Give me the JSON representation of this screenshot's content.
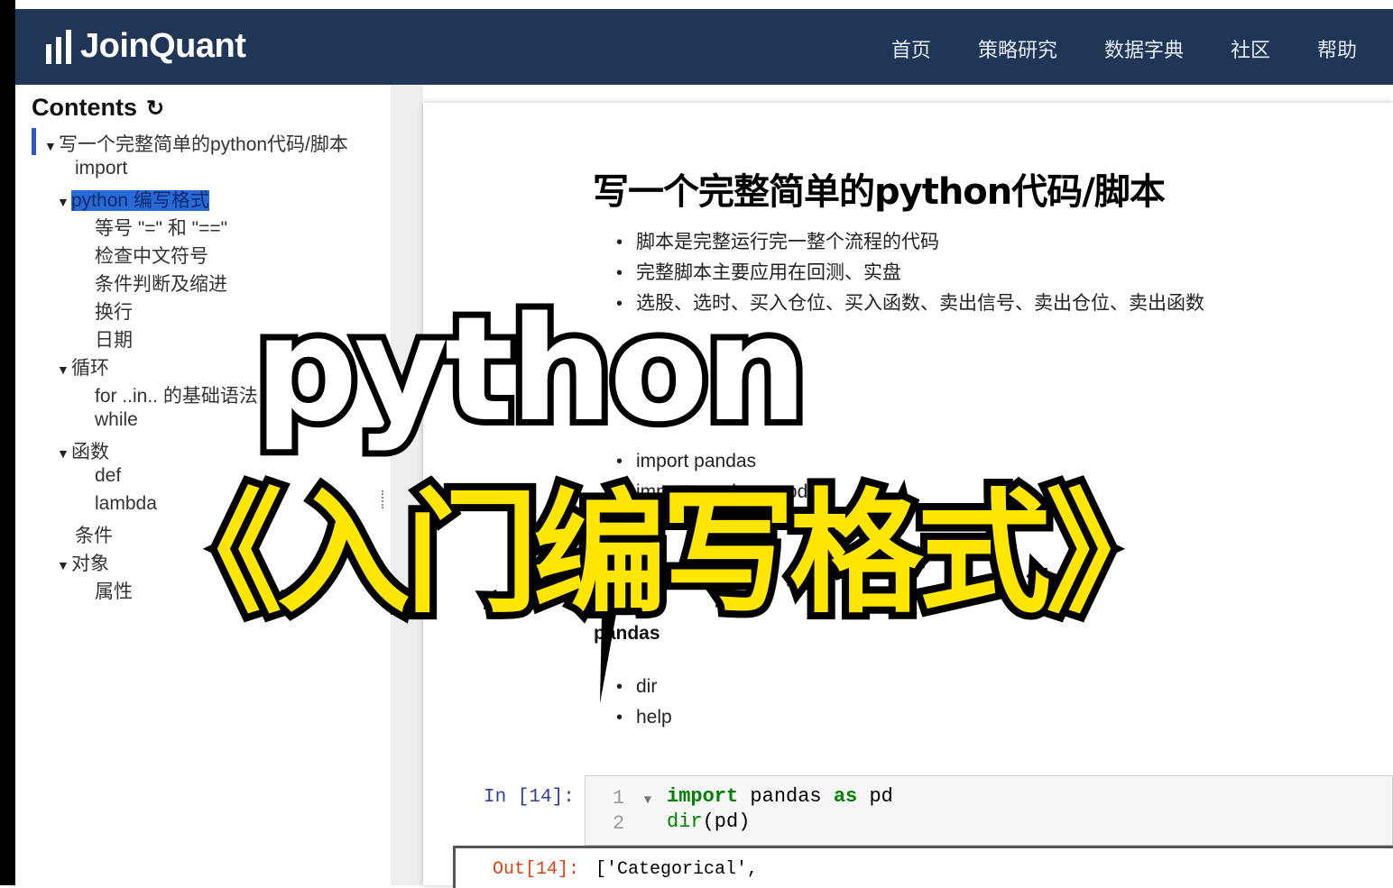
{
  "navbar": {
    "brand": "JoinQuant",
    "items": [
      "首页",
      "策略研究",
      "数据字典",
      "社区",
      "帮助"
    ]
  },
  "toc": {
    "title": "Contents",
    "items": [
      {
        "label": "写一个完整简单的python代码/脚本",
        "caret": "▼"
      },
      {
        "label": "import",
        "caret": ""
      },
      {
        "label": "python 编写格式",
        "caret": "▼"
      },
      {
        "label": "等号 \"=\" 和 \"==\"",
        "caret": ""
      },
      {
        "label": "检查中文符号",
        "caret": ""
      },
      {
        "label": "条件判断及缩进",
        "caret": ""
      },
      {
        "label": "换行",
        "caret": ""
      },
      {
        "label": "日期",
        "caret": ""
      },
      {
        "label": "循环",
        "caret": "▼"
      },
      {
        "label": "for ..in.. 的基础语法",
        "caret": ""
      },
      {
        "label": "while",
        "caret": ""
      },
      {
        "label": "函数",
        "caret": "▼"
      },
      {
        "label": "def",
        "caret": ""
      },
      {
        "label": "lambda",
        "caret": ""
      },
      {
        "label": "条件",
        "caret": ""
      },
      {
        "label": "对象",
        "caret": "▼"
      },
      {
        "label": "属性",
        "caret": ""
      }
    ]
  },
  "main": {
    "heading": "写一个完整简单的python代码/脚本",
    "bullets1": [
      "脚本是完整运行完一整个流程的代码",
      "完整脚本主要应用在回测、实盘",
      "选股、选时、买入仓位、买入函数、卖出信号、卖出仓位、卖出函数"
    ],
    "bullets2": [
      "import pandas",
      "import pandas as pd"
    ],
    "pandas_heading": "pandas",
    "bullets3": [
      "dir",
      "help"
    ]
  },
  "cell": {
    "in_prompt": "In  [14]:",
    "out_prompt": "Out[14]:",
    "line_numbers": [
      "1",
      "2"
    ],
    "line1": {
      "kw1": "import",
      "mid": " pandas ",
      "kw2": "as",
      "end": " pd"
    },
    "line2": {
      "fn": "dir",
      "rest": "(pd)"
    },
    "output": "['Categorical',"
  },
  "overlay": {
    "python": "python",
    "title": "《入门编写格式》"
  }
}
